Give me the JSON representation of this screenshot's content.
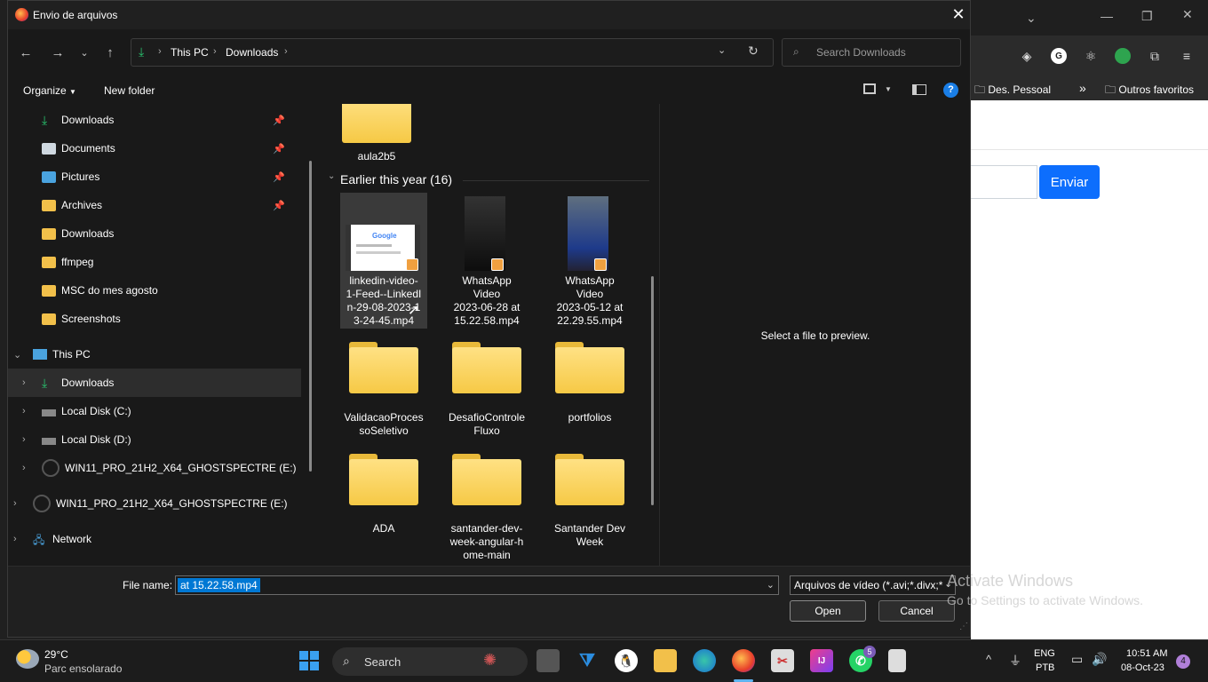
{
  "dialog": {
    "title": "Envio de arquivos",
    "close": "✕",
    "breadcrumb": [
      "This PC",
      "Downloads"
    ],
    "search_placeholder": "Search Downloads",
    "organize": "Organize",
    "new_folder": "New folder",
    "help": "?"
  },
  "nav_pane": {
    "quick": [
      {
        "label": "Downloads",
        "icon": "download-icon",
        "pinned": true
      },
      {
        "label": "Documents",
        "icon": "document-icon",
        "pinned": true
      },
      {
        "label": "Pictures",
        "icon": "pictures-icon",
        "pinned": true
      },
      {
        "label": "Archives",
        "icon": "folder-icon",
        "pinned": true
      },
      {
        "label": "Downloads",
        "icon": "folder-icon",
        "pinned": false
      },
      {
        "label": "ffmpeg",
        "icon": "folder-icon",
        "pinned": false
      },
      {
        "label": "MSC do mes agosto",
        "icon": "folder-icon",
        "pinned": false
      },
      {
        "label": "Screenshots",
        "icon": "folder-icon",
        "pinned": false
      }
    ],
    "this_pc": "This PC",
    "this_pc_items": [
      "Downloads",
      "Local Disk (C:)",
      "Local Disk (D:)",
      "WIN11_PRO_21H2_X64_GHOSTSPECTRE (E:)"
    ],
    "drive_e": "WIN11_PRO_21H2_X64_GHOSTSPECTRE (E:)",
    "network": "Network"
  },
  "files": {
    "top_folder": "aula2b5",
    "group_header": "Earlier this year (16)",
    "videos": [
      [
        "linkedin-video-",
        "1-Feed--LinkedI",
        "n-29-08-2023-1",
        "3-24-45.mp4"
      ],
      [
        "WhatsApp",
        "Video",
        "2023-06-28 at",
        "15.22.58.mp4"
      ],
      [
        "WhatsApp",
        "Video",
        "2023-05-12 at",
        "22.29.55.mp4"
      ]
    ],
    "folders_row1": [
      [
        "ValidacaoProces",
        "soSeletivo"
      ],
      [
        "DesafioControle",
        "Fluxo"
      ],
      [
        "portfolios"
      ]
    ],
    "folders_row2": [
      [
        "ADA"
      ],
      [
        "santander-dev-",
        "week-angular-h",
        "ome-main"
      ],
      [
        "Santander Dev",
        "Week"
      ]
    ]
  },
  "preview_text": "Select a file to preview.",
  "bottom": {
    "file_name_label": "File name:",
    "file_name_value": "at 15.22.58.mp4",
    "file_type": "Arquivos de vídeo (*.avi;*.divx;*",
    "open": "Open",
    "cancel": "Cancel"
  },
  "browser": {
    "bookmark1": "Des. Pessoal",
    "bookmark2": "Outros favoritos",
    "enviar": "Enviar",
    "activate_title": "Activate Windows",
    "activate_sub": "Go to Settings to activate Windows."
  },
  "taskbar": {
    "temp": "29°C",
    "weather": "Parc ensolarado",
    "search": "Search",
    "lang1": "ENG",
    "lang2": "PTB",
    "time": "10:51 AM",
    "date": "08-Oct-23",
    "notif": "4",
    "whatsapp_badge": "5"
  }
}
